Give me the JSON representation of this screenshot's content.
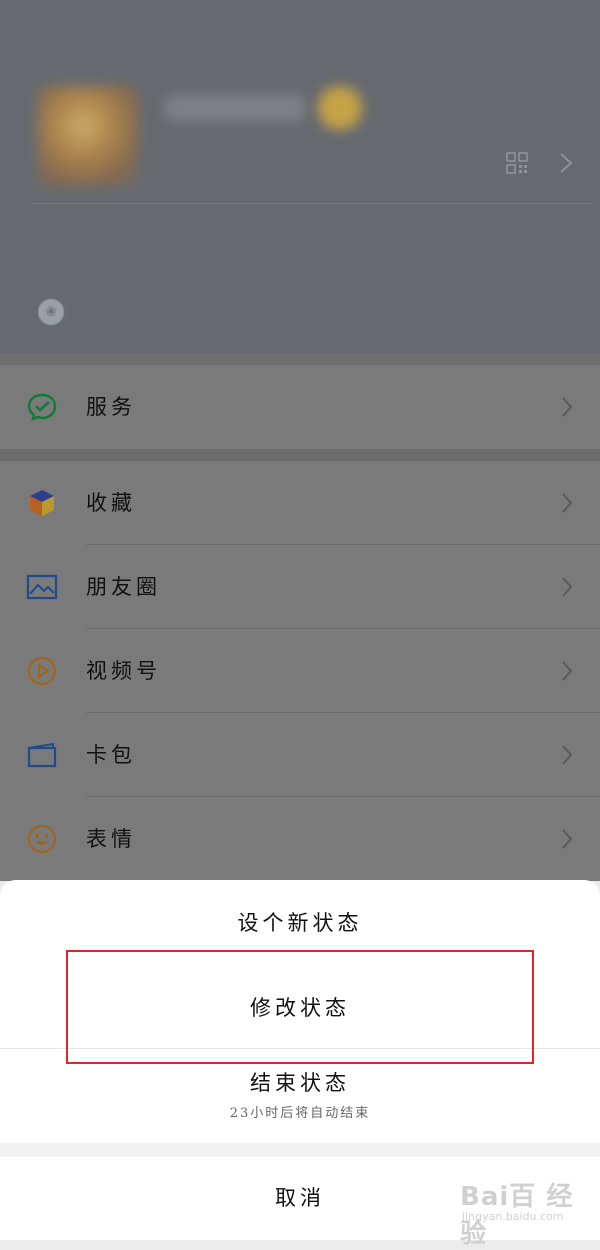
{
  "menu": {
    "items": [
      {
        "label": "服务",
        "icon": "wechat-pay-icon"
      },
      {
        "label": "收藏",
        "icon": "favorites-cube-icon"
      },
      {
        "label": "朋友圈",
        "icon": "moments-image-icon"
      },
      {
        "label": "视频号",
        "icon": "channels-play-icon"
      },
      {
        "label": "卡包",
        "icon": "card-wallet-icon"
      },
      {
        "label": "表情",
        "icon": "smiley-icon"
      }
    ]
  },
  "sheet": {
    "option_new": "设个新状态",
    "option_edit": "修改状态",
    "option_end": "结束状态",
    "option_end_sub": "23小时后将自动结束",
    "cancel": "取消"
  },
  "watermark": {
    "brand": "Bai百 经验",
    "url": "jingyan.baidu.com"
  },
  "colors": {
    "highlight": "#e0242b",
    "overlay": "#6e6e6e"
  }
}
